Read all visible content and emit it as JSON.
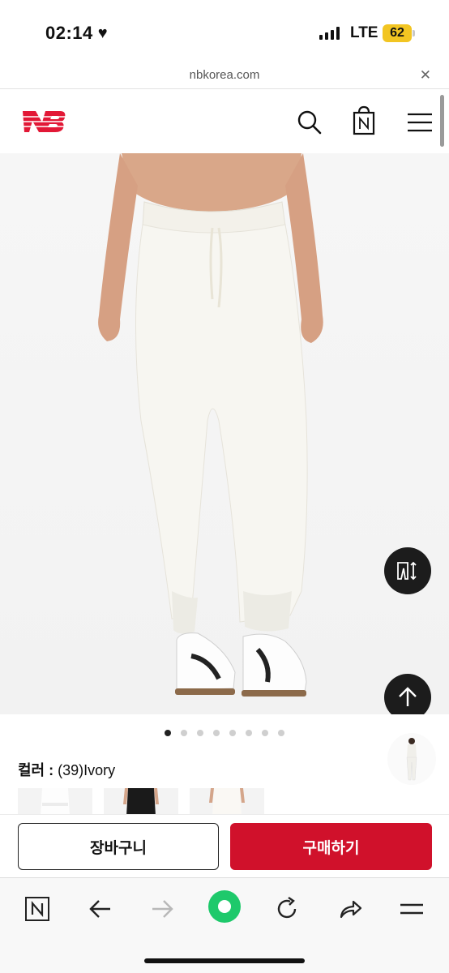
{
  "status_bar": {
    "time": "02:14",
    "network": "LTE",
    "battery": "62"
  },
  "browser": {
    "url": "nbkorea.com",
    "close_glyph": "✕"
  },
  "site_header": {
    "logo_name": "new-balance-logo",
    "icons": [
      "search-icon",
      "shopping-bag-icon",
      "menu-icon"
    ],
    "brand_color": "#e21836"
  },
  "product": {
    "image_name": "white-sweatpants-product-photo",
    "carousel_total": 8,
    "carousel_active": 1,
    "color_label": "컬러 :",
    "color_value": "(39)Ivory",
    "swatches": [
      "ivory",
      "black",
      "ivory-alt"
    ]
  },
  "actions": {
    "cart_label": "장바구니",
    "buy_label": "구매하기",
    "buy_color": "#d0112b"
  },
  "browser_toolbar": {
    "icons": [
      "naver-home-icon",
      "back-arrow-icon",
      "forward-arrow-icon",
      "green-circle-icon",
      "refresh-icon",
      "share-icon",
      "menu-icon"
    ],
    "accent": "#1ec96b"
  }
}
